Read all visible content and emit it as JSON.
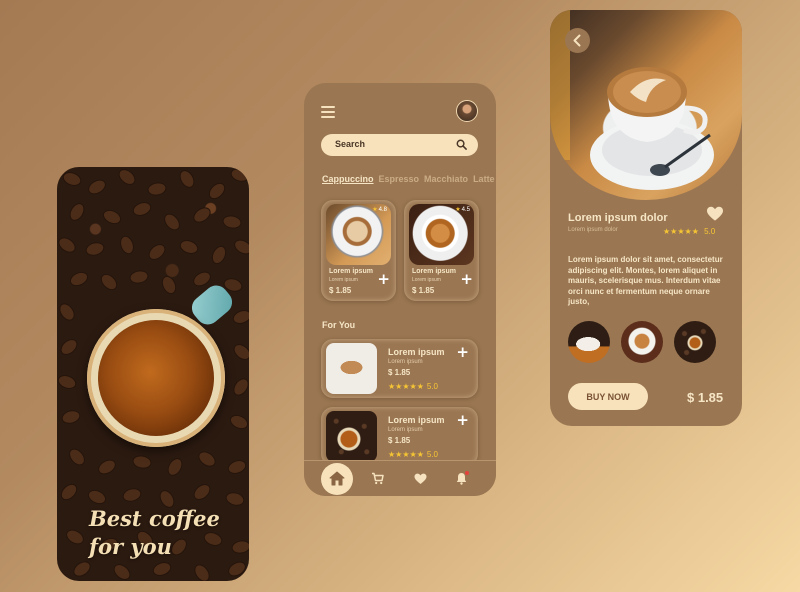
{
  "splash": {
    "title_line1": "Best coffee",
    "title_line2": "for you"
  },
  "home": {
    "search": {
      "placeholder": "Search"
    },
    "categories": [
      {
        "label": "Cappuccino",
        "active": true
      },
      {
        "label": "Espresso",
        "active": false
      },
      {
        "label": "Macchiato",
        "active": false
      },
      {
        "label": "Latte",
        "active": false
      }
    ],
    "popular": [
      {
        "name": "Lorem ipsum",
        "sub": "Lorem ipsum",
        "price": "$ 1.85",
        "rating": "4.8"
      },
      {
        "name": "Lorem ipsum",
        "sub": "Lorem ipsum",
        "price": "$ 1.85",
        "rating": "4.5"
      }
    ],
    "for_you_title": "For You",
    "for_you": [
      {
        "name": "Lorem ipsum",
        "sub": "Lorem ipsum",
        "price": "$ 1.85",
        "stars": "★★★★★",
        "rating": "5.0"
      },
      {
        "name": "Lorem ipsum",
        "sub": "Lorem ipsum",
        "price": "$ 1.85",
        "stars": "★★★★★",
        "rating": "5.0"
      }
    ],
    "plus_label": "+",
    "nav": [
      "home-icon",
      "cart-icon",
      "heart-icon",
      "bell-icon"
    ]
  },
  "detail": {
    "title": "Lorem ipsum dolor",
    "subtitle": "Lorem ipsum dolor",
    "stars": "★★★★★",
    "rating": "5.0",
    "description": "Lorem ipsum dolor sit amet, consectetur adipiscing elit. Montes, lorem aliquet in mauris, scelerisque mus. Interdum vitae orci nunc et fermentum neque ornare justo,",
    "buy_label": "BUY NOW",
    "price": "$ 1.85"
  },
  "colors": {
    "panel": "#9a7652",
    "cream": "#f7e2bc",
    "star": "#f6c534",
    "notification": "#e5433a"
  }
}
